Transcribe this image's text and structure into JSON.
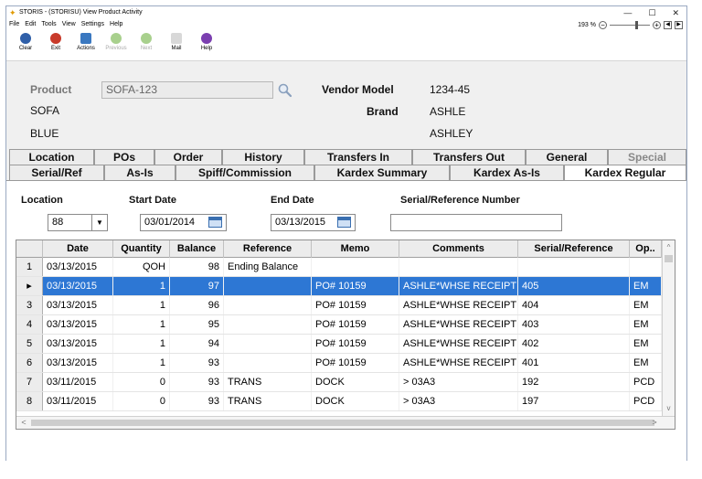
{
  "window": {
    "title": "STORIS - (STORISU) View Product Activity",
    "controls": {
      "minimize": "—",
      "maximize": "☐",
      "close": "✕"
    }
  },
  "menu": [
    "File",
    "Edit",
    "Tools",
    "View",
    "Settings",
    "Help"
  ],
  "zoom": {
    "level": "193 %",
    "minus": "−",
    "plus": "+",
    "prev": "◀",
    "next": "▶"
  },
  "toolbar": [
    {
      "label": "Clear",
      "icon": "clear-icon",
      "color": "#2f5fa8",
      "enabled": true
    },
    {
      "label": "Exit",
      "icon": "exit-icon",
      "color": "#c83a2a",
      "enabled": true
    },
    {
      "label": "Actions",
      "icon": "actions-icon",
      "color": "#3a78c0",
      "enabled": true
    },
    {
      "label": "Previous",
      "icon": "previous-icon",
      "color": "#a8d08d",
      "enabled": false
    },
    {
      "label": "Next",
      "icon": "next-icon",
      "color": "#a8d08d",
      "enabled": false
    },
    {
      "label": "Mail",
      "icon": "mail-icon",
      "color": "#d8d8d8",
      "enabled": true
    },
    {
      "label": "Help",
      "icon": "help-icon",
      "color": "#7b3fb0",
      "enabled": true
    }
  ],
  "header": {
    "product_label": "Product",
    "product_value": "SOFA-123",
    "description1": "SOFA",
    "description2": "BLUE",
    "vendor_model_label": "Vendor Model",
    "vendor_model_value": "1234-45",
    "brand_label": "Brand",
    "brand_value": "ASHLE",
    "brand_name": "ASHLEY"
  },
  "tabs_row1": [
    "Location",
    "POs",
    "Order",
    "History",
    "Transfers In",
    "Transfers Out",
    "General",
    "Special"
  ],
  "tabs_row2": [
    "Serial/Ref",
    "As-Is",
    "Spiff/Commission",
    "Kardex Summary",
    "Kardex As-Is",
    "Kardex Regular"
  ],
  "active_tab": "Kardex Regular",
  "filters": {
    "location_label": "Location",
    "location_value": "88",
    "start_date_label": "Start Date",
    "start_date_value": "03/01/2014",
    "end_date_label": "End Date",
    "end_date_value": "03/13/2015",
    "serial_label": "Serial/Reference Number",
    "serial_value": ""
  },
  "grid": {
    "columns": [
      "Date",
      "Quantity",
      "Balance",
      "Reference",
      "Memo",
      "Comments",
      "Serial/Reference",
      "Op.."
    ],
    "selected_row_marker": "▸",
    "rows": [
      {
        "rh": "1",
        "date": "03/13/2015",
        "qty": "QOH",
        "bal": "98",
        "ref": "Ending Balance",
        "memo": "",
        "comments": "",
        "serial": "",
        "op": ""
      },
      {
        "rh": "",
        "date": "03/13/2015",
        "qty": "1",
        "bal": "97",
        "ref": "",
        "memo": "PO# 10159",
        "comments": "ASHLE*WHSE RECEIPT",
        "serial": "405",
        "op": "EM"
      },
      {
        "rh": "3",
        "date": "03/13/2015",
        "qty": "1",
        "bal": "96",
        "ref": "",
        "memo": "PO# 10159",
        "comments": "ASHLE*WHSE RECEIPT",
        "serial": "404",
        "op": "EM"
      },
      {
        "rh": "4",
        "date": "03/13/2015",
        "qty": "1",
        "bal": "95",
        "ref": "",
        "memo": "PO# 10159",
        "comments": "ASHLE*WHSE RECEIPT",
        "serial": "403",
        "op": "EM"
      },
      {
        "rh": "5",
        "date": "03/13/2015",
        "qty": "1",
        "bal": "94",
        "ref": "",
        "memo": "PO# 10159",
        "comments": "ASHLE*WHSE RECEIPT",
        "serial": "402",
        "op": "EM"
      },
      {
        "rh": "6",
        "date": "03/13/2015",
        "qty": "1",
        "bal": "93",
        "ref": "",
        "memo": "PO# 10159",
        "comments": "ASHLE*WHSE RECEIPT",
        "serial": "401",
        "op": "EM"
      },
      {
        "rh": "7",
        "date": "03/11/2015",
        "qty": "0",
        "bal": "93",
        "ref": "TRANS",
        "memo": "DOCK",
        "comments": "> 03A3",
        "serial": "192",
        "op": "PCD"
      },
      {
        "rh": "8",
        "date": "03/11/2015",
        "qty": "0",
        "bal": "93",
        "ref": "TRANS",
        "memo": "DOCK",
        "comments": "> 03A3",
        "serial": "197",
        "op": "PCD"
      }
    ],
    "selected_index": 1
  },
  "scroll": {
    "up": "^",
    "down": "v",
    "left": "<",
    "right": ">"
  }
}
